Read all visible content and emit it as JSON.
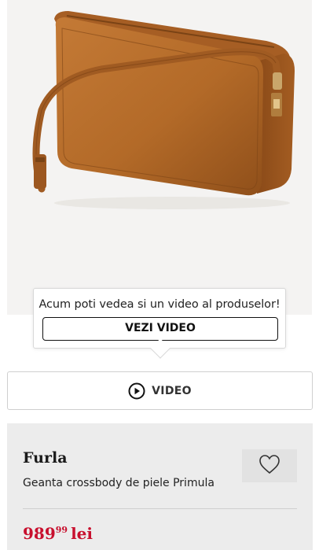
{
  "product_image": {
    "alt": "Geanta crossbody de piele Primula"
  },
  "video_tooltip": {
    "message": "Acum poti vedea si un video al produselor!",
    "button_label": "VEZI VIDEO"
  },
  "video_bar": {
    "label": "VIDEO",
    "icon": "play-circle-icon"
  },
  "product": {
    "brand": "Furla",
    "name": "Geanta crossbody de piele Primula",
    "favorite_icon": "heart-icon",
    "price": {
      "main": "989",
      "decimals": "99",
      "currency": "lei"
    }
  },
  "colors": {
    "price": "#c8102e",
    "info_background": "#ececec",
    "bag_leather": "#b86b2b"
  }
}
